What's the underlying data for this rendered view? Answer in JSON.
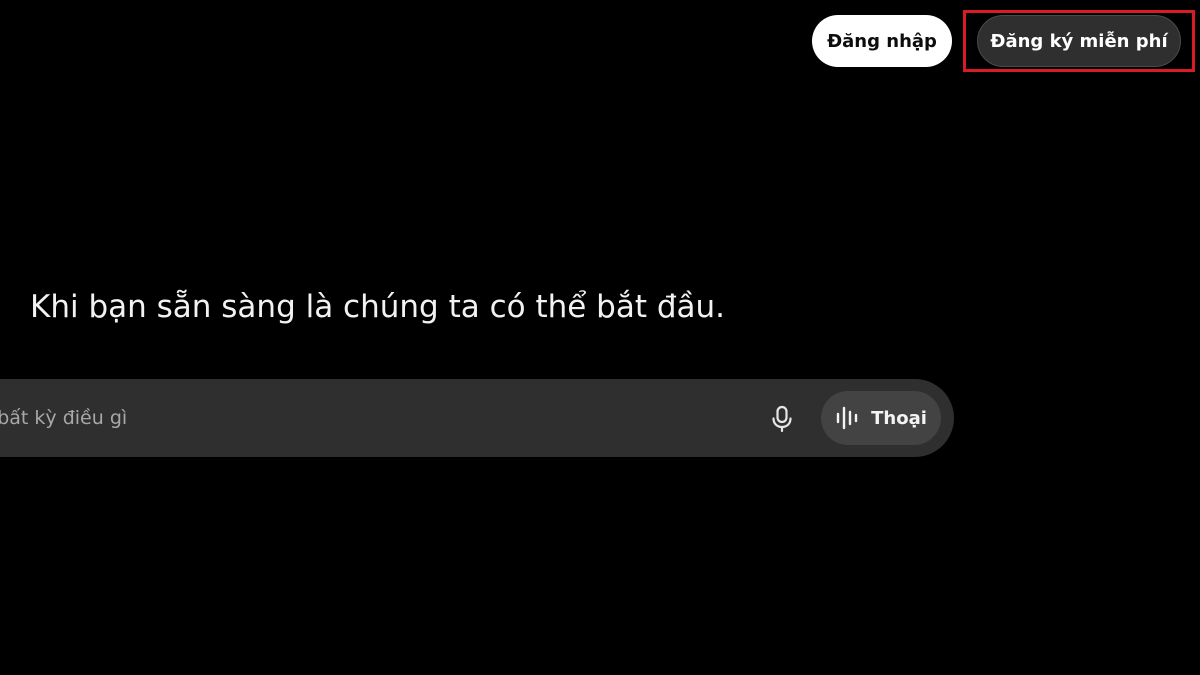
{
  "header": {
    "login_label": "Đăng nhập",
    "signup_label": "Đăng ký miễn phí"
  },
  "main": {
    "headline": "Khi bạn sẵn sàng là chúng ta có thể bắt đầu."
  },
  "composer": {
    "placeholder": "Hỏi bất kỳ điều gì",
    "voice_label": "Thoại"
  },
  "icons": {
    "mic": "microphone-icon",
    "voice": "audio-waveform-icon"
  },
  "colors": {
    "background": "#000000",
    "login_button": "#ffffff",
    "signup_button": "#2f2f2f",
    "composer": "#2f2f2f",
    "voice_button": "#434343",
    "highlight_border": "#d81b27"
  }
}
